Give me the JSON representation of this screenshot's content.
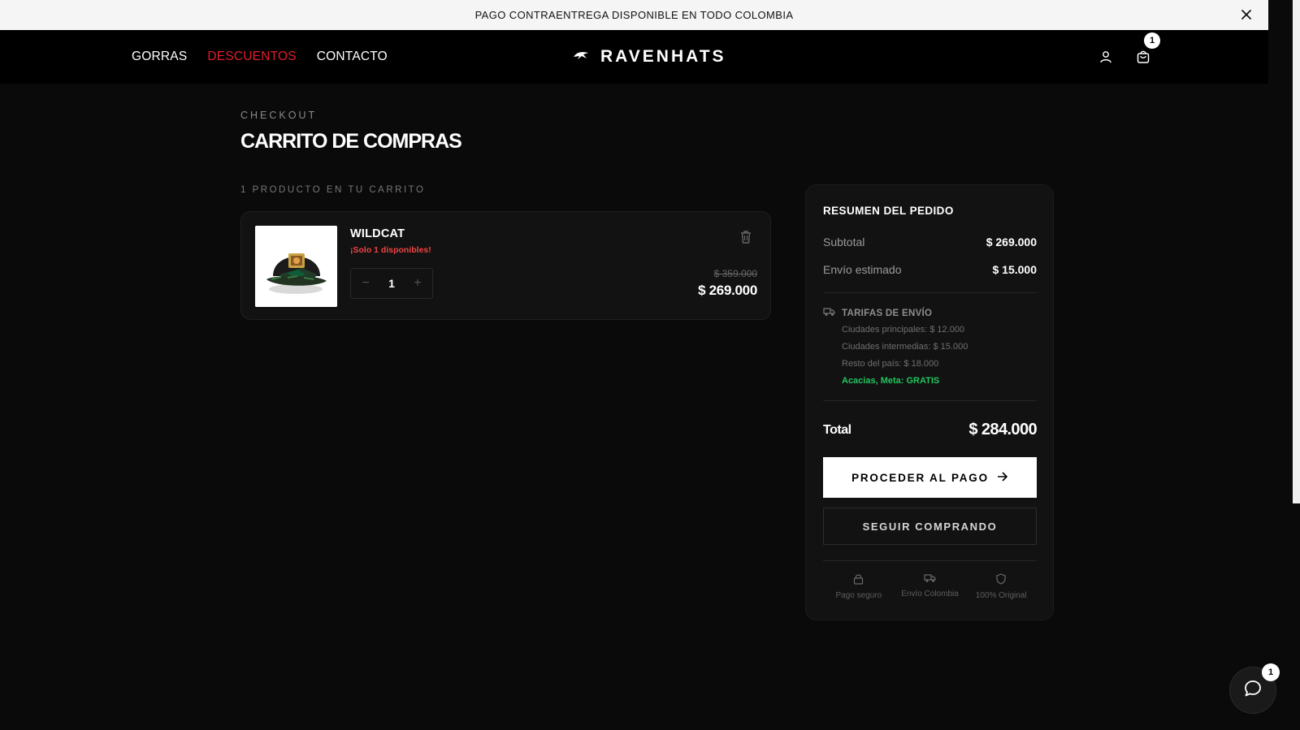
{
  "announcement": {
    "text": "PAGO CONTRAENTREGA DISPONIBLE EN TODO COLOMBIA",
    "close_icon": "close-icon"
  },
  "nav": {
    "items": [
      "GORRAS",
      "DESCUENTOS",
      "CONTACTO"
    ],
    "highlight_color": "#e11d2a"
  },
  "brand": {
    "name": "RAVENHATS",
    "logo_icon": "raven-icon"
  },
  "header_icons": {
    "account_icon": "user-icon",
    "cart_icon": "shopping-bag-icon",
    "cart_count": "1"
  },
  "page": {
    "breadcrumb": "CHECKOUT",
    "title": "CARRITO DE COMPRAS",
    "count_text": "1 PRODUCTO EN TU CARRITO"
  },
  "cart_items": [
    {
      "name": "WILDCAT",
      "stock": "¡Solo 1 disponibles!",
      "quantity": "1",
      "old_price": "$ 359.000",
      "price": "$ 269.000",
      "remove_icon": "trash-icon",
      "image_icon": "cap-image"
    }
  ],
  "summary": {
    "title": "RESUMEN DEL PEDIDO",
    "subtotal_label": "Subtotal",
    "subtotal_value": "$ 269.000",
    "shipping_label": "Envío estimado",
    "shipping_value": "$ 15.000",
    "rates_title": "TARIFAS DE ENVÍO",
    "rates": [
      "Ciudades principales: $ 12.000",
      "Ciudades intermedias: $ 15.000",
      "Resto del país: $ 18.000"
    ],
    "free_rate": "Acacias, Meta: GRATIS",
    "total_label": "Total",
    "total_value": "$ 284.000",
    "checkout_label": "PROCEDER AL PAGO",
    "continue_label": "SEGUIR COMPRANDO",
    "trust": [
      "Pago seguro",
      "Envío Colombia",
      "100% Original"
    ]
  },
  "chat": {
    "icon": "chat-bubble-icon",
    "badge": "1"
  }
}
